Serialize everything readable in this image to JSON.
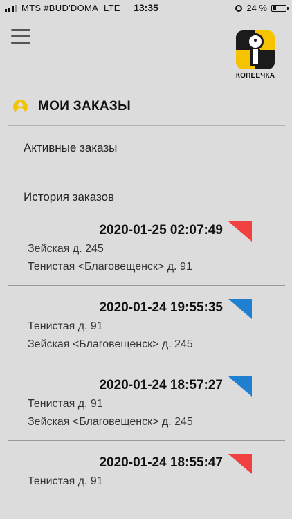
{
  "status_bar": {
    "carrier": "MTS #BUD'DOMA",
    "network": "LTE",
    "time": "13:35",
    "battery": "24 %"
  },
  "logo": {
    "text": "КОПЕЕЧКА"
  },
  "section": {
    "title": "МОИ ЗАКАЗЫ"
  },
  "nav": {
    "active_label": "Активные заказы",
    "history_label": "История заказов"
  },
  "colors": {
    "red_flag": "#f04040",
    "blue_flag": "#1f7fd0",
    "brand_yellow": "#f5c300"
  },
  "orders": [
    {
      "datetime": "2020-01-25 02:07:49",
      "from": "Зейская  д. 245",
      "to": "Тенистая <Благовещенск> д. 91",
      "flag": "red"
    },
    {
      "datetime": "2020-01-24 19:55:35",
      "from": "Тенистая  д. 91",
      "to": "Зейская <Благовещенск> д. 245",
      "flag": "blue"
    },
    {
      "datetime": "2020-01-24 18:57:27",
      "from": "Тенистая  д. 91",
      "to": "Зейская <Благовещенск> д. 245",
      "flag": "blue"
    },
    {
      "datetime": "2020-01-24 18:55:47",
      "from": "Тенистая  д. 91",
      "to": "",
      "flag": "red"
    }
  ]
}
